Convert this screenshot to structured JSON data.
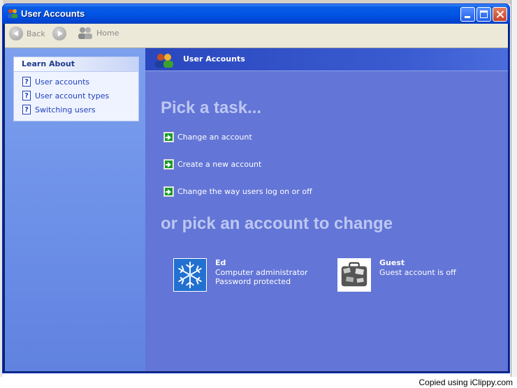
{
  "window": {
    "title": "User Accounts"
  },
  "toolbar": {
    "back_label": "Back",
    "home_label": "Home"
  },
  "learn_about": {
    "heading": "Learn About",
    "items": [
      {
        "label": "User accounts",
        "icon": "help-icon"
      },
      {
        "label": "User account types",
        "icon": "help-icon"
      },
      {
        "label": "Switching users",
        "icon": "help-icon"
      }
    ]
  },
  "main": {
    "header_title": "User Accounts",
    "pick_task_title": "Pick a task...",
    "tasks": [
      {
        "label": "Change an account",
        "icon": "green-arrow-icon"
      },
      {
        "label": "Create a new account",
        "icon": "green-arrow-icon"
      },
      {
        "label": "Change the way users log on or off",
        "icon": "green-arrow-icon"
      }
    ],
    "pick_account_title": "or pick an account to change",
    "accounts": [
      {
        "name": "Ed",
        "line1": "Computer administrator",
        "line2": "Password protected",
        "picture": "snowflake-icon"
      },
      {
        "name": "Guest",
        "line1": "Guest account is off",
        "line2": "",
        "picture": "suitcase-icon"
      }
    ]
  },
  "caption": "Copied using iClippy.com",
  "colors": {
    "titlebar": "#0055e5",
    "right_pane": "#6375d6",
    "left_pane": "#7ca0ee",
    "heading_light": "#bcc7f3",
    "link_blue": "#1f3fbf"
  }
}
